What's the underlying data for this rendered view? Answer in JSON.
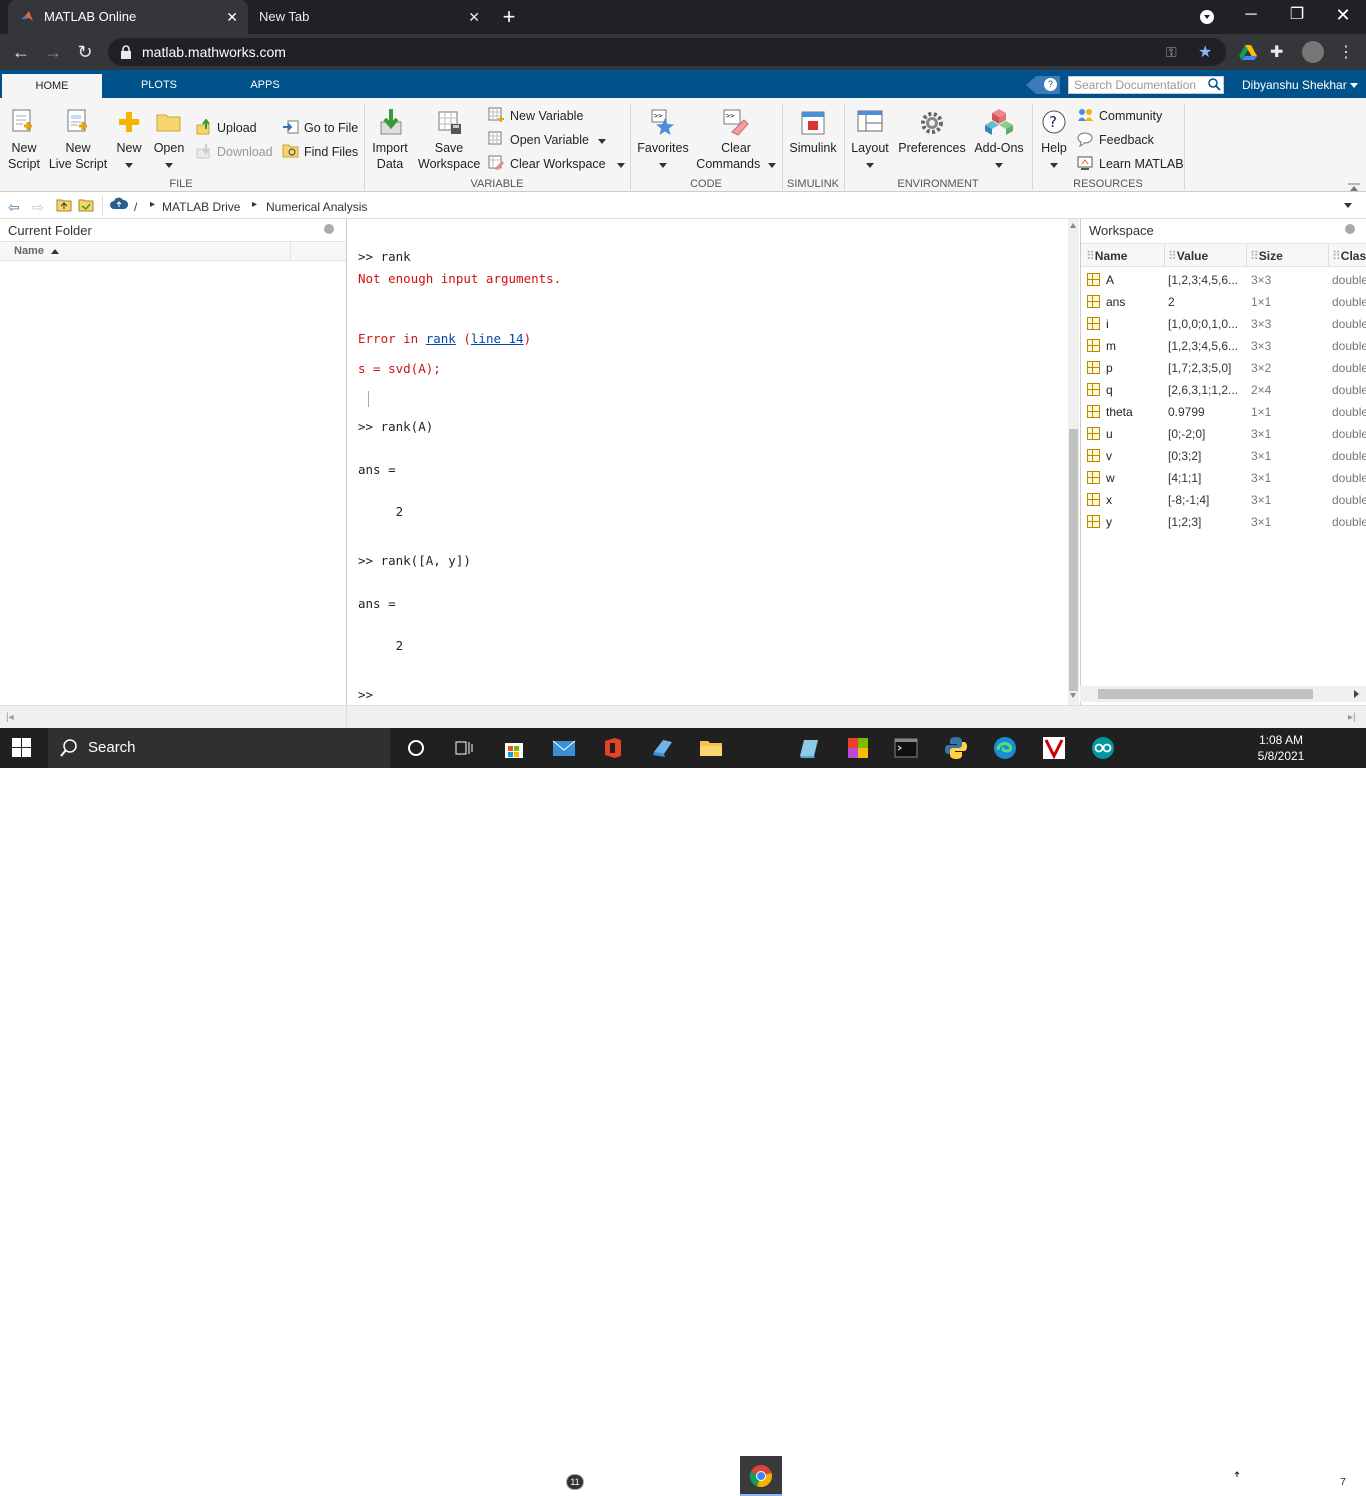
{
  "browser": {
    "tabs": [
      {
        "title": "MATLAB Online"
      },
      {
        "title": "New Tab"
      }
    ],
    "url": "matlab.mathworks.com"
  },
  "matlab": {
    "tabs": [
      "HOME",
      "PLOTS",
      "APPS"
    ],
    "search_placeholder": "Search Documentation",
    "user": "Dibyanshu Shekhar"
  },
  "ribbon": {
    "file": {
      "new_script": [
        "New",
        "Script"
      ],
      "new_live_script": [
        "New",
        "Live Script"
      ],
      "new": "New",
      "open": "Open",
      "upload": "Upload",
      "download": "Download",
      "go_to_file": "Go to File",
      "find_files": "Find Files",
      "section": "FILE"
    },
    "variable": {
      "import": [
        "Import",
        "Data"
      ],
      "save": [
        "Save",
        "Workspace"
      ],
      "new_variable": "New Variable",
      "open_variable": "Open Variable",
      "clear_workspace": "Clear Workspace",
      "section": "VARIABLE"
    },
    "code": {
      "favorites": "Favorites",
      "clear_commands": [
        "Clear",
        "Commands"
      ],
      "section": "CODE"
    },
    "simulink": {
      "label": "Simulink",
      "section": "SIMULINK"
    },
    "environment": {
      "layout": "Layout",
      "preferences": "Preferences",
      "addons": "Add-Ons",
      "section": "ENVIRONMENT"
    },
    "resources": {
      "help": "Help",
      "community": "Community",
      "feedback": "Feedback",
      "learn": "Learn MATLAB",
      "section": "RESOURCES"
    }
  },
  "path": {
    "root": "/",
    "items": [
      "MATLAB Drive",
      "Numerical Analysis"
    ]
  },
  "current_folder": {
    "title": "Current Folder",
    "col_name": "Name"
  },
  "command_window": {
    "lines": {
      "l1": ">> rank",
      "l2": "Not enough input arguments.",
      "l3_pre": "Error in ",
      "l3_link1": "rank",
      "l3_mid": " (",
      "l3_link2": "line 14",
      "l3_post": ")",
      "l4": "s = svd(A);",
      "l5": ">> rank(A)",
      "l6": "ans =",
      "l7": "     2",
      "l8": ">> rank([A, y])",
      "l9": "ans =",
      "l10": "     2",
      "l11": ">>"
    }
  },
  "workspace": {
    "title": "Workspace",
    "columns": [
      "Name",
      "Value",
      "Size",
      "Clas"
    ],
    "rows": [
      {
        "name": "A",
        "value": "[1,2,3;4,5,6...",
        "size": "3×3",
        "class": "double"
      },
      {
        "name": "ans",
        "value": "2",
        "size": "1×1",
        "class": "double"
      },
      {
        "name": "i",
        "value": "[1,0,0;0,1,0...",
        "size": "3×3",
        "class": "double"
      },
      {
        "name": "m",
        "value": "[1,2,3;4,5,6...",
        "size": "3×3",
        "class": "double"
      },
      {
        "name": "p",
        "value": "[1,7;2,3;5,0]",
        "size": "3×2",
        "class": "double"
      },
      {
        "name": "q",
        "value": "[2,6,3,1;1,2...",
        "size": "2×4",
        "class": "double"
      },
      {
        "name": "theta",
        "value": "0.9799",
        "size": "1×1",
        "class": "double"
      },
      {
        "name": "u",
        "value": "[0;-2;0]",
        "size": "3×1",
        "class": "double"
      },
      {
        "name": "v",
        "value": "[0;3;2]",
        "size": "3×1",
        "class": "double"
      },
      {
        "name": "w",
        "value": "[4;1;1]",
        "size": "3×1",
        "class": "double"
      },
      {
        "name": "x",
        "value": "[-8;-1;4]",
        "size": "3×1",
        "class": "double"
      },
      {
        "name": "y",
        "value": "[1;2;3]",
        "size": "3×1",
        "class": "double"
      }
    ]
  },
  "taskbar": {
    "search": "Search",
    "mail_badge": "11",
    "time": "1:08 AM",
    "date": "5/8/2021",
    "notif_count": "7"
  }
}
